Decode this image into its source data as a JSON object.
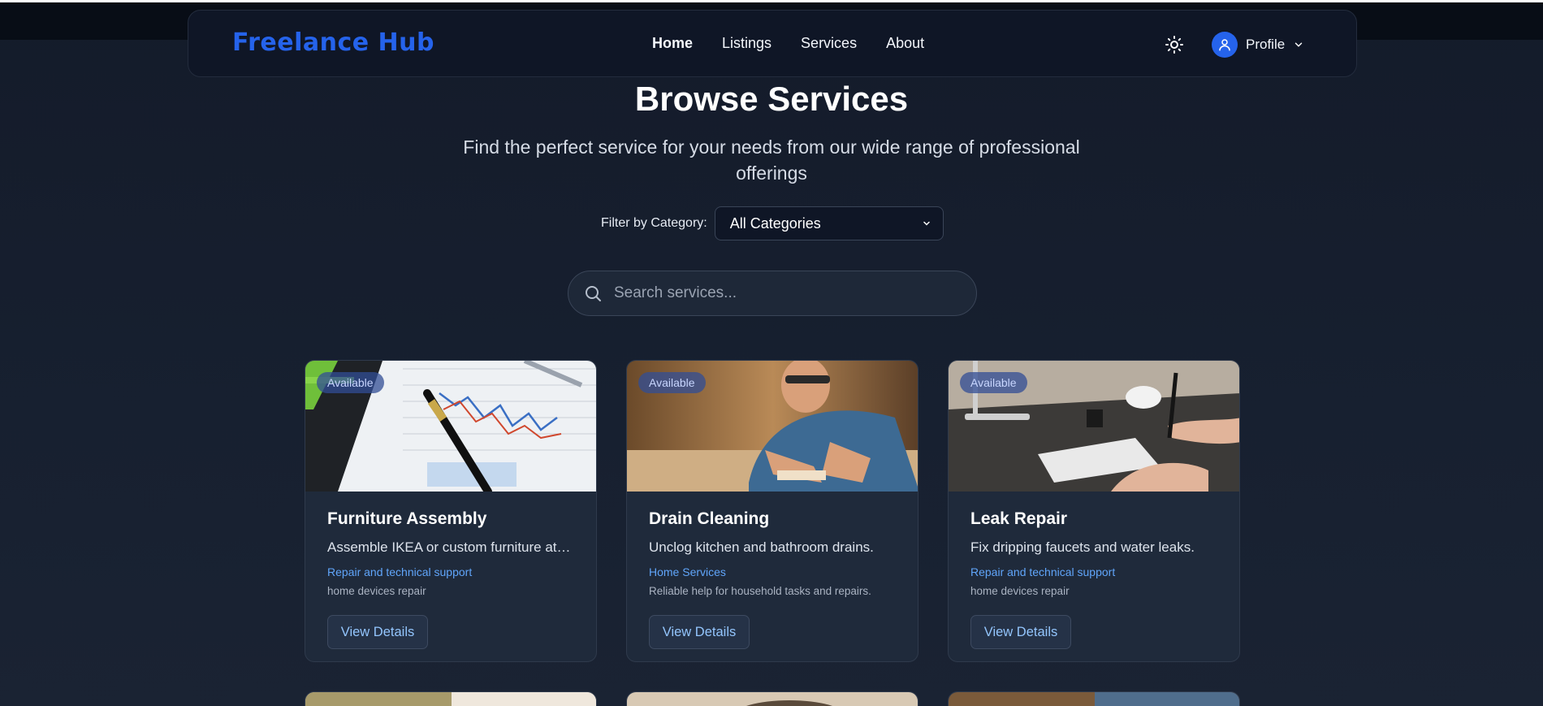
{
  "brand": "Freelance Hub",
  "nav": {
    "links": [
      {
        "label": "Home",
        "active": true
      },
      {
        "label": "Listings",
        "active": false
      },
      {
        "label": "Services",
        "active": false
      },
      {
        "label": "About",
        "active": false
      }
    ],
    "profile_label": "Profile"
  },
  "header": {
    "title": "Browse Services",
    "subtitle_line1": "Find the perfect service for your needs from our wide range of professional",
    "subtitle_line2": "offerings"
  },
  "filter": {
    "label": "Filter by Category:",
    "selected": "All Categories"
  },
  "search": {
    "placeholder": "Search services..."
  },
  "cards": [
    {
      "badge": "Available",
      "title": "Furniture Assembly",
      "description": "Assemble IKEA or custom furniture at home.",
      "category": "Repair and technical support",
      "subcategory": "home devices repair",
      "button": "View Details"
    },
    {
      "badge": "Available",
      "title": "Drain Cleaning",
      "description": "Unclog kitchen and bathroom drains.",
      "category": "Home Services",
      "subcategory": "Reliable help for household tasks and repairs.",
      "button": "View Details"
    },
    {
      "badge": "Available",
      "title": "Leak Repair",
      "description": "Fix dripping faucets and water leaks.",
      "category": "Repair and technical support",
      "subcategory": "home devices repair",
      "button": "View Details"
    }
  ],
  "colors": {
    "accent": "#2563eb",
    "link": "#60a5fa",
    "background": "#172030"
  }
}
